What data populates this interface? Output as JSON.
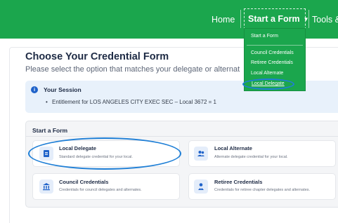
{
  "nav": {
    "home": "Home",
    "start_form": "Start a Form",
    "tools": "Tools &"
  },
  "dropdown": {
    "header": "Start a Form",
    "items": [
      "Council Credentials",
      "Retiree Credentials",
      "Local Alternate",
      "Local Delegate"
    ]
  },
  "page": {
    "title": "Choose Your Credential Form",
    "subtitle": "Please select the option that matches your delegate or alternat"
  },
  "session": {
    "label": "Your Session",
    "entitlement": "Entitlement for LOS ANGELES CITY EXEC SEC – Local 3672 = 1"
  },
  "start_section": {
    "label": "Start a Form",
    "cards": [
      {
        "title": "Local Delegate",
        "desc": "Standard delegate credential for your local.",
        "icon": "id-badge-icon"
      },
      {
        "title": "Local Alternate",
        "desc": "Alternate delegate credential for your local.",
        "icon": "users-icon"
      },
      {
        "title": "Council Credentials",
        "desc": "Credentials for council delegates and alternates.",
        "icon": "institution-icon"
      },
      {
        "title": "Retiree Credentials",
        "desc": "Credentials for retiree chapter delegates and alternates.",
        "icon": "user-tie-icon"
      }
    ]
  },
  "colors": {
    "nav_green": "#1ba64d",
    "annotation_blue": "#1f7fd6",
    "icon_blue": "#1f62c9"
  }
}
